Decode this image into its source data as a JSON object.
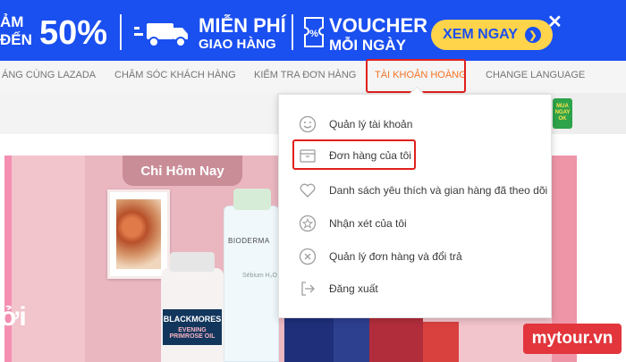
{
  "promo": {
    "line1": "ẢM",
    "line2": "ĐẾN",
    "percent": "50%",
    "freeship_title": "MIỄN PHÍ",
    "freeship_sub": "GIAO HÀNG",
    "voucher_title": "VOUCHER",
    "voucher_sub": "MỖI NGÀY",
    "cta_label": "XEM NGAY",
    "close_glyph": "✕",
    "background": "#1a4ff0",
    "cta_color": "#ffd34a"
  },
  "nav": {
    "items": [
      "ÁNG CÙNG LAZADA",
      "CHĂM SÓC KHÁCH HÀNG",
      "KIỂM TRA ĐƠN HÀNG",
      "TÀI KHOẢN HOÀNG",
      "CHANGE LANGUAGE"
    ],
    "active_index": 3,
    "active_color": "#f57224"
  },
  "account_menu": {
    "items": [
      {
        "label": "Quản lý tài khoản",
        "icon": "smiley-icon"
      },
      {
        "label": "Đơn hàng của tôi",
        "icon": "package-box-icon"
      },
      {
        "label": "Danh sách yêu thích và gian hàng đã theo dõi",
        "icon": "heart-icon"
      },
      {
        "label": "Nhận xét của tôi",
        "icon": "star-icon"
      },
      {
        "label": "Quản lý đơn hàng và đổi trả",
        "icon": "cancel-circle-icon"
      },
      {
        "label": "Đăng xuất",
        "icon": "logout-icon"
      }
    ],
    "highlighted_index": 1,
    "highlight_color": "#e0201b"
  },
  "hero": {
    "chip_text": "Chỉ Hôm Nay",
    "left_char": "ởi",
    "product1_brand": "BLACKMORES",
    "product1_sub": "EVENING PRIMROSE OIL",
    "product2_brand": "BIODERMA",
    "product2_sub": "Sébium H₂O"
  },
  "side_badge": {
    "text": "MUA NGAY OK"
  },
  "watermark": {
    "text": "mytour.vn"
  }
}
